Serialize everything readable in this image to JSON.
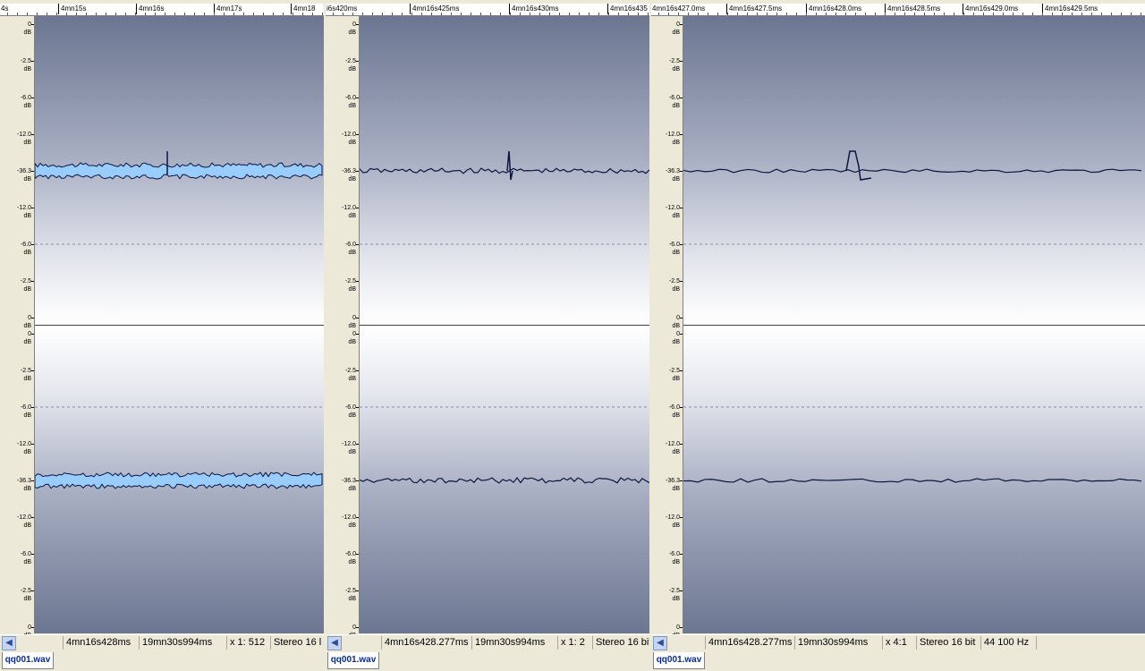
{
  "db_scale": [
    "0",
    "-2.5",
    "-6.0",
    "-12.0",
    "-36.3",
    "-12.0",
    "-6.0",
    "-2.5",
    "0"
  ],
  "db_unit": "dB",
  "panels": [
    {
      "ruler": [
        "4s",
        "4mn15s",
        "4mn16s",
        "4mn17s",
        "4mn18"
      ],
      "status": {
        "position": "4mn16s428ms",
        "length": "19mn30s994ms",
        "zoom": "x 1: 512",
        "format": "Stereo 16 l"
      },
      "tab": "qq001.wav"
    },
    {
      "ruler": [
        "i6s420ms",
        "4mn16s425ms",
        "4mn16s430ms",
        "4mn16s435"
      ],
      "status": {
        "position": "4mn16s428.277ms",
        "length": "19mn30s994ms",
        "zoom": "x 1: 2",
        "format": "Stereo 16 bit"
      },
      "tab": "qq001.wav"
    },
    {
      "ruler": [
        "4mn16s427.0ms",
        "4mn16s427.5ms",
        "4mn16s428.0ms",
        "4mn16s428.5ms",
        "4mn16s429.0ms",
        "4mn16s429.5ms"
      ],
      "status": {
        "position": "4mn16s428.277ms",
        "length": "19mn30s994ms",
        "zoom": "x 4:1",
        "format": "Stereo 16 bit",
        "rate": "44 100 Hz"
      },
      "tab": "qq001.wav"
    }
  ],
  "colors": {
    "wave_fill": "#99ccff",
    "wave_line": "#0a1640",
    "bg_dark": "#6c7691"
  }
}
